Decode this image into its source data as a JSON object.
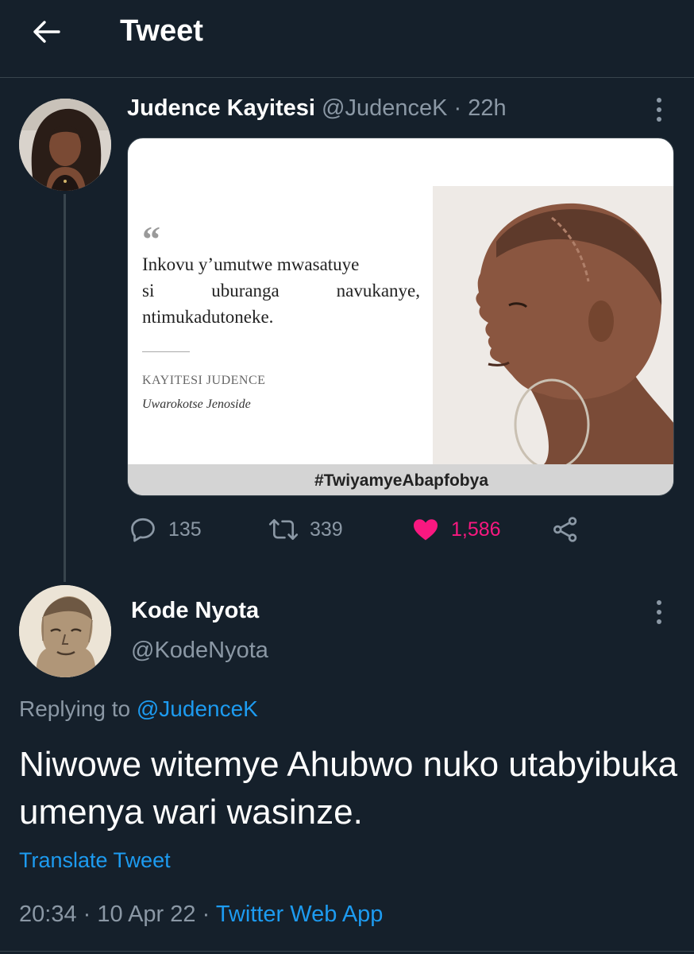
{
  "header": {
    "title": "Tweet"
  },
  "tweet": {
    "author_name": "Judence Kayitesi",
    "author_handle": "@JudenceK",
    "separator": "·",
    "time_ago": "22h",
    "media": {
      "quote_mark": "“",
      "quote_lines": [
        "Inkovu y’umutwe mwasatuye",
        [
          "si",
          "uburanga",
          "navukanye,"
        ],
        "ntimukadutoneke."
      ],
      "quote_author": "KAYITESI JUDENCE",
      "quote_subtitle": "Uwarokotse Jenoside",
      "hashtag": "#TwiyamyeAbapfobya"
    },
    "stats": {
      "replies": "135",
      "retweets": "339",
      "likes": "1,586"
    },
    "colors": {
      "like": "#f91880",
      "muted": "#8b98a5"
    }
  },
  "reply": {
    "author_name": "Kode Nyota",
    "author_handle": "@KodeNyota",
    "replying_prefix": "Replying to",
    "replying_to": "@JudenceK",
    "text": "Niwowe witemye Ahubwo nuko utabyibuka umenya wari wasinze.",
    "translate_label": "Translate Tweet",
    "time": "20:34",
    "separator": "·",
    "date": "10 Apr 22",
    "source": "Twitter Web App"
  },
  "icons": [
    "back-arrow-icon",
    "more-icon",
    "reply-icon",
    "retweet-icon",
    "heart-icon",
    "share-icon"
  ],
  "theme": {
    "background": "#15202b",
    "border": "#38444d",
    "link": "#1d9bf0"
  }
}
